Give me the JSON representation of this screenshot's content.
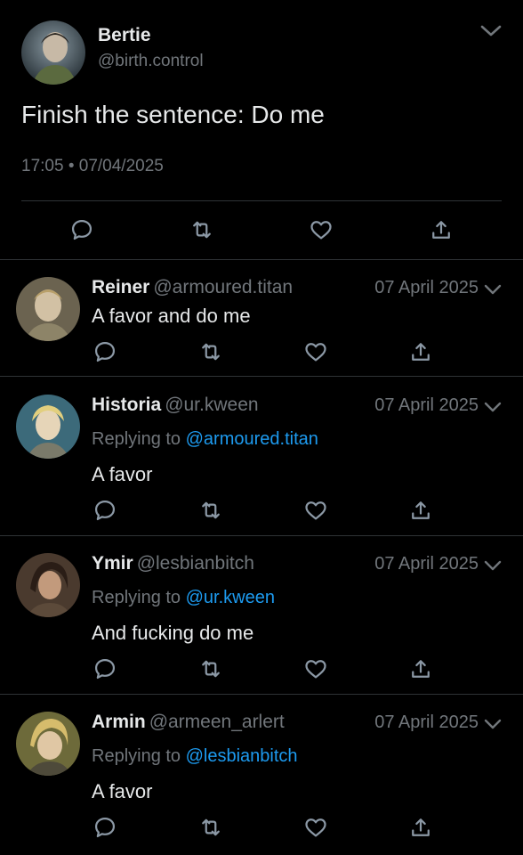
{
  "main_tweet": {
    "name": "Bertie",
    "handle": "@birth.control",
    "text": "Finish the sentence: Do me",
    "timestamp": "17:05 • 07/04/2025",
    "avatar_colors": [
      "#3e4a52",
      "#8a9aa3"
    ],
    "actions": [
      "reply-icon",
      "retweet-icon",
      "like-icon",
      "share-icon"
    ]
  },
  "replies": [
    {
      "name": "Reiner",
      "handle": "@armoured.titan",
      "date": "07 April 2025",
      "replying_prefix": "",
      "replying_to": "",
      "text": "A favor and do me",
      "avatar_colors": [
        "#6b6350",
        "#b9a98a"
      ]
    },
    {
      "name": "Historia",
      "handle": "@ur.kween",
      "date": "07 April 2025",
      "replying_prefix": "Replying to",
      "replying_to": "@armoured.titan",
      "text": "A favor",
      "avatar_colors": [
        "#3c6a7a",
        "#d8c98c"
      ]
    },
    {
      "name": "Ymir",
      "handle": "@lesbianbitch",
      "date": "07 April 2025",
      "replying_prefix": "Replying to",
      "replying_to": "@ur.kween",
      "text": "And fucking do me",
      "avatar_colors": [
        "#4a3a2e",
        "#9c7a5e"
      ]
    },
    {
      "name": "Armin",
      "handle": "@armeen_arlert",
      "date": "07 April 2025",
      "replying_prefix": "Replying to",
      "replying_to": "@lesbianbitch",
      "text": "A favor",
      "avatar_colors": [
        "#6d6a3a",
        "#d6c27a"
      ]
    }
  ],
  "colors": {
    "background": "#000000",
    "text": "#e7e9ea",
    "secondary": "#71767b",
    "link": "#1d9bf0",
    "divider": "#2f3336"
  }
}
